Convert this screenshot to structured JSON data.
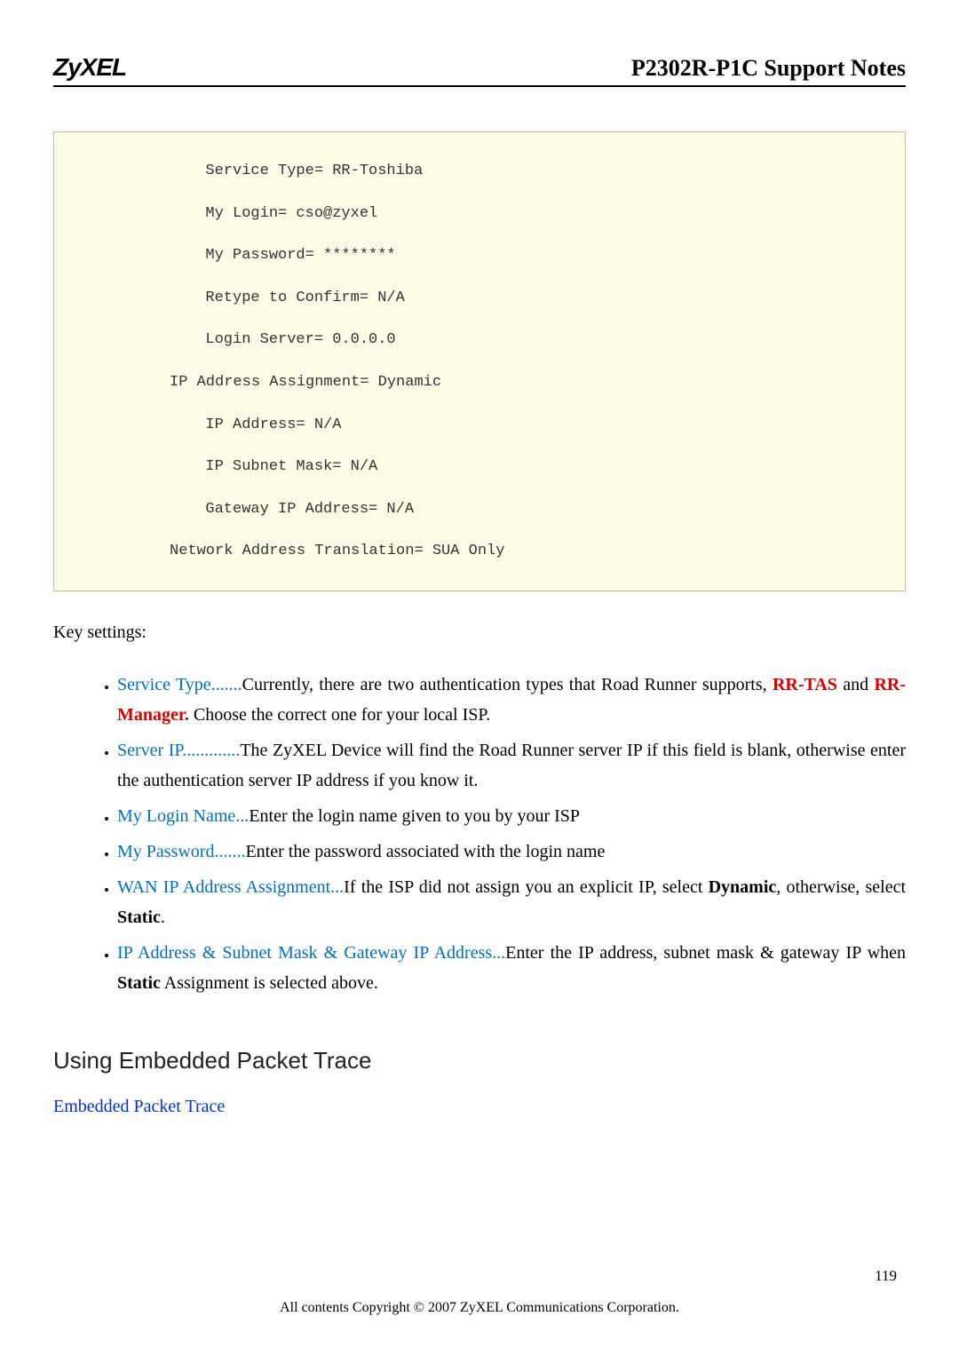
{
  "header": {
    "logo": "ZyXEL",
    "title": "P2302R-P1C Support Notes"
  },
  "code": {
    "l1": "  Service Type= RR-Toshiba",
    "l2": "  My Login= cso@zyxel",
    "l3": "  My Password= ********",
    "l4": "  Retype to Confirm= N/A",
    "l5": "  Login Server= 0.0.0.0",
    "l6": "IP Address Assignment= Dynamic",
    "l7": "  IP Address= N/A",
    "l8": "  IP Subnet Mask= N/A",
    "l9": "  Gateway IP Address= N/A",
    "l10": "Network Address Translation= SUA Only"
  },
  "keySettings": "Key settings:",
  "bullets": {
    "b1": {
      "label": "Service Type.......",
      "t1": "Currently, there are two authentication types that Road Runner supports, ",
      "r1": "RR-TAS",
      "t2": " and ",
      "r2": "RR-Manager.",
      "t3": " Choose the correct one for your local ISP."
    },
    "b2": {
      "label": "Server IP.............",
      "t1": "The ZyXEL Device will find the Road Runner server IP if this field is blank, otherwise enter the authentication  server IP address if you know it."
    },
    "b3": {
      "label": "My Login Name...",
      "t1": "Enter the login name given to you by your ISP"
    },
    "b4": {
      "label": "My Password.......",
      "t1": "Enter the password associated with the login name"
    },
    "b5": {
      "label": "WAN IP Address Assignment...",
      "t1": "If the ISP did not assign you an explicit IP, select ",
      "s1": "Dynamic",
      "t2": ", otherwise, select ",
      "s2": "Static",
      "t3": "."
    },
    "b6": {
      "label": "IP Address & Subnet Mask & Gateway IP Address...",
      "t1": "Enter the IP address, subnet mask & gateway IP when ",
      "s1": "Static",
      "t2": " Assignment is selected above."
    }
  },
  "section": {
    "heading": "Using Embedded Packet Trace",
    "sub": "Embedded Packet Trace"
  },
  "footer": {
    "copyright": "All contents Copyright © 2007 ZyXEL Communications Corporation.",
    "page": "119"
  }
}
